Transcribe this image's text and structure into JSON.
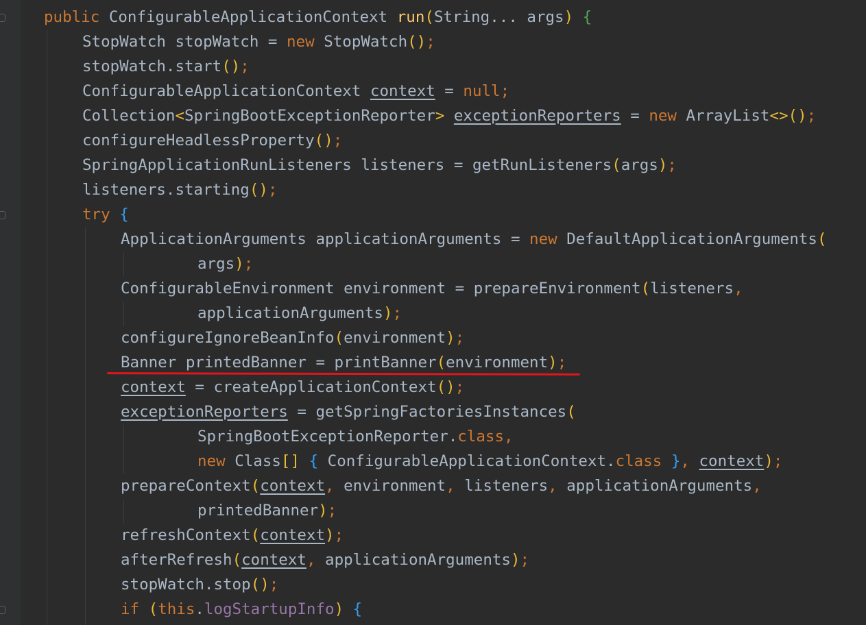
{
  "editor": {
    "language": "java",
    "lines": [
      {
        "indent": 0,
        "tokens": [
          {
            "t": "public ",
            "c": "kw"
          },
          {
            "t": "ConfigurableApplicationContext "
          },
          {
            "t": "run",
            "c": "fn"
          },
          {
            "t": "(",
            "c": "p1"
          },
          {
            "t": "String... args"
          },
          {
            "t": ") ",
            "c": "p1"
          },
          {
            "t": "{",
            "c": "p2"
          }
        ]
      },
      {
        "indent": 1,
        "tokens": [
          {
            "t": "StopWatch stopWatch = "
          },
          {
            "t": "new ",
            "c": "kw"
          },
          {
            "t": "StopWatch"
          },
          {
            "t": "()",
            "c": "p1"
          },
          {
            "t": ";",
            "c": "kw"
          }
        ]
      },
      {
        "indent": 1,
        "tokens": [
          {
            "t": "stopWatch.start"
          },
          {
            "t": "()",
            "c": "p1"
          },
          {
            "t": ";",
            "c": "kw"
          }
        ]
      },
      {
        "indent": 1,
        "tokens": [
          {
            "t": "ConfigurableApplicationContext "
          },
          {
            "t": "context",
            "u": true
          },
          {
            "t": " = "
          },
          {
            "t": "null",
            "c": "kw"
          },
          {
            "t": ";",
            "c": "kw"
          }
        ]
      },
      {
        "indent": 1,
        "tokens": [
          {
            "t": "Collection"
          },
          {
            "t": "<",
            "c": "p1"
          },
          {
            "t": "SpringBootExceptionReporter"
          },
          {
            "t": ">",
            "c": "p1"
          },
          {
            "t": " "
          },
          {
            "t": "exceptionReporters",
            "u": true
          },
          {
            "t": " = "
          },
          {
            "t": "new ",
            "c": "kw"
          },
          {
            "t": "ArrayList"
          },
          {
            "t": "<>()",
            "c": "p1"
          },
          {
            "t": ";",
            "c": "kw"
          }
        ]
      },
      {
        "indent": 1,
        "tokens": [
          {
            "t": "configureHeadlessProperty"
          },
          {
            "t": "()",
            "c": "p1"
          },
          {
            "t": ";",
            "c": "kw"
          }
        ]
      },
      {
        "indent": 1,
        "tokens": [
          {
            "t": "SpringApplicationRunListeners listeners = getRunListeners"
          },
          {
            "t": "(",
            "c": "p1"
          },
          {
            "t": "args"
          },
          {
            "t": ")",
            "c": "p1"
          },
          {
            "t": ";",
            "c": "kw"
          }
        ]
      },
      {
        "indent": 1,
        "tokens": [
          {
            "t": "listeners.starting"
          },
          {
            "t": "()",
            "c": "p1"
          },
          {
            "t": ";",
            "c": "kw"
          }
        ]
      },
      {
        "indent": 1,
        "tokens": [
          {
            "t": "try ",
            "c": "kw"
          },
          {
            "t": "{",
            "c": "p3"
          }
        ]
      },
      {
        "indent": 2,
        "tokens": [
          {
            "t": "ApplicationArguments applicationArguments = "
          },
          {
            "t": "new ",
            "c": "kw"
          },
          {
            "t": "DefaultApplicationArguments"
          },
          {
            "t": "(",
            "c": "p1"
          }
        ]
      },
      {
        "indent": 4,
        "tokens": [
          {
            "t": "args"
          },
          {
            "t": ")",
            "c": "p1"
          },
          {
            "t": ";",
            "c": "kw"
          }
        ]
      },
      {
        "indent": 2,
        "tokens": [
          {
            "t": "ConfigurableEnvironment environment = prepareEnvironment"
          },
          {
            "t": "(",
            "c": "p1"
          },
          {
            "t": "listeners"
          },
          {
            "t": ",",
            "c": "kw"
          }
        ]
      },
      {
        "indent": 4,
        "tokens": [
          {
            "t": "applicationArguments"
          },
          {
            "t": ")",
            "c": "p1"
          },
          {
            "t": ";",
            "c": "kw"
          }
        ]
      },
      {
        "indent": 2,
        "tokens": [
          {
            "t": "configureIgnoreBeanInfo"
          },
          {
            "t": "(",
            "c": "p1"
          },
          {
            "t": "environment"
          },
          {
            "t": ")",
            "c": "p1"
          },
          {
            "t": ";",
            "c": "kw"
          }
        ]
      },
      {
        "indent": 2,
        "tokens": [
          {
            "t": "Banner printedBanner = printBanner"
          },
          {
            "t": "(",
            "c": "p1"
          },
          {
            "t": "environment"
          },
          {
            "t": ")",
            "c": "p1"
          },
          {
            "t": ";",
            "c": "kw"
          }
        ]
      },
      {
        "indent": 2,
        "tokens": [
          {
            "t": "context",
            "u": true
          },
          {
            "t": " = createApplicationContext"
          },
          {
            "t": "()",
            "c": "p1"
          },
          {
            "t": ";",
            "c": "kw"
          }
        ]
      },
      {
        "indent": 2,
        "tokens": [
          {
            "t": "exceptionReporters",
            "u": true
          },
          {
            "t": " = getSpringFactoriesInstances"
          },
          {
            "t": "(",
            "c": "p1"
          }
        ]
      },
      {
        "indent": 4,
        "tokens": [
          {
            "t": "SpringBootExceptionReporter."
          },
          {
            "t": "class",
            "c": "kw"
          },
          {
            "t": ",",
            "c": "kw"
          }
        ]
      },
      {
        "indent": 4,
        "tokens": [
          {
            "t": "new ",
            "c": "kw"
          },
          {
            "t": "Class"
          },
          {
            "t": "[]",
            "c": "p1"
          },
          {
            "t": " "
          },
          {
            "t": "{",
            "c": "p3"
          },
          {
            "t": " ConfigurableApplicationContext."
          },
          {
            "t": "class",
            "c": "kw"
          },
          {
            "t": " "
          },
          {
            "t": "}",
            "c": "p3"
          },
          {
            "t": ",",
            "c": "kw"
          },
          {
            "t": " "
          },
          {
            "t": "context",
            "u": true
          },
          {
            "t": ")",
            "c": "p1"
          },
          {
            "t": ";",
            "c": "kw"
          }
        ]
      },
      {
        "indent": 2,
        "tokens": [
          {
            "t": "prepareContext"
          },
          {
            "t": "(",
            "c": "p1"
          },
          {
            "t": "context",
            "u": true
          },
          {
            "t": ",",
            "c": "kw"
          },
          {
            "t": " environment"
          },
          {
            "t": ",",
            "c": "kw"
          },
          {
            "t": " listeners"
          },
          {
            "t": ",",
            "c": "kw"
          },
          {
            "t": " applicationArguments"
          },
          {
            "t": ",",
            "c": "kw"
          }
        ]
      },
      {
        "indent": 4,
        "tokens": [
          {
            "t": "printedBanner"
          },
          {
            "t": ")",
            "c": "p1"
          },
          {
            "t": ";",
            "c": "kw"
          }
        ]
      },
      {
        "indent": 2,
        "tokens": [
          {
            "t": "refreshContext"
          },
          {
            "t": "(",
            "c": "p1"
          },
          {
            "t": "context",
            "u": true
          },
          {
            "t": ")",
            "c": "p1"
          },
          {
            "t": ";",
            "c": "kw"
          }
        ]
      },
      {
        "indent": 2,
        "tokens": [
          {
            "t": "afterRefresh"
          },
          {
            "t": "(",
            "c": "p1"
          },
          {
            "t": "context",
            "u": true
          },
          {
            "t": ",",
            "c": "kw"
          },
          {
            "t": " applicationArguments"
          },
          {
            "t": ")",
            "c": "p1"
          },
          {
            "t": ";",
            "c": "kw"
          }
        ]
      },
      {
        "indent": 2,
        "tokens": [
          {
            "t": "stopWatch.stop"
          },
          {
            "t": "()",
            "c": "p1"
          },
          {
            "t": ";",
            "c": "kw"
          }
        ]
      },
      {
        "indent": 2,
        "tokens": [
          {
            "t": "if ",
            "c": "kw"
          },
          {
            "t": "(",
            "c": "p1"
          },
          {
            "t": "this",
            "c": "kw"
          },
          {
            "t": "."
          },
          {
            "t": "logStartupInfo",
            "c": "fld"
          },
          {
            "t": ") ",
            "c": "p1"
          },
          {
            "t": "{",
            "c": "p3"
          }
        ]
      }
    ]
  },
  "colors": {
    "background": "#2b2b2b",
    "keyword": "#cc7832",
    "method_decl": "#ffc66d",
    "field": "#9876aa",
    "default_text": "#a9b7c6",
    "highlight_underline": "#e0161c"
  }
}
